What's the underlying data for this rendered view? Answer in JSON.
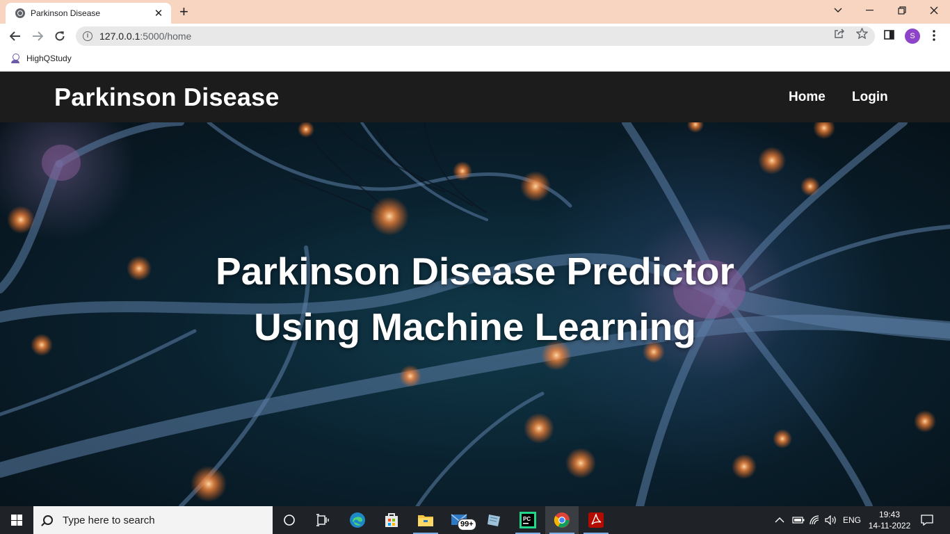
{
  "browser": {
    "tab_title": "Parkinson Disease",
    "tab_close": "✕",
    "new_tab": "+",
    "url_host": "127.0.0.1",
    "url_path": ":5000/home",
    "avatar_letter": "S",
    "bookmark_label": "HighQStudy"
  },
  "site": {
    "brand": "Parkinson Disease",
    "nav": {
      "home": "Home",
      "login": "Login"
    },
    "hero_line1": "Parkinson Disease Predictor",
    "hero_line2": "Using Machine Learning"
  },
  "taskbar": {
    "search_placeholder": "Type here to search",
    "mail_badge": "99+",
    "language": "ENG",
    "time": "19:43",
    "date": "14-11-2022"
  },
  "colors": {
    "tab_strip": "#f8d5c0",
    "site_nav": "#1c1c1c",
    "taskbar": "#1f2226",
    "avatar": "#8e44c9"
  }
}
